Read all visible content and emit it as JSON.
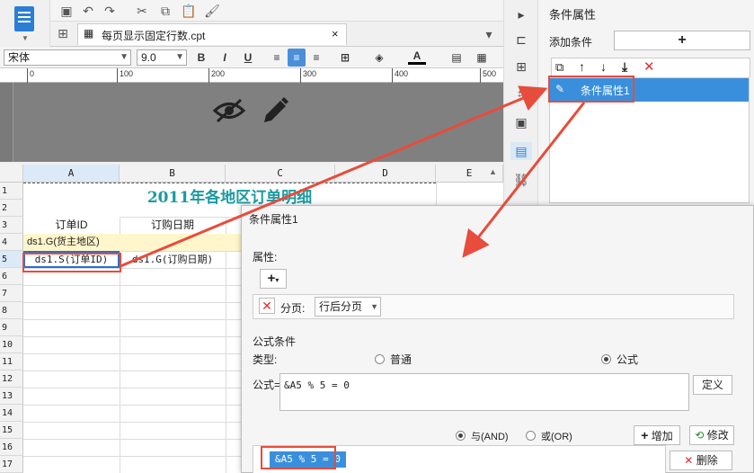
{
  "tab": {
    "filename": "每页显示固定行数.cpt"
  },
  "format": {
    "font": "宋体",
    "size": "9.0"
  },
  "ruler": {
    "marks": [
      "0",
      "100",
      "200",
      "300",
      "400",
      "500"
    ]
  },
  "sheet": {
    "columns": [
      "A",
      "B",
      "C",
      "D",
      "E"
    ],
    "rows": [
      "1 (H)",
      "2 (H)",
      "3 (H)",
      "4 (H)",
      "5",
      "6",
      "7",
      "8",
      "9",
      "10",
      "11",
      "12",
      "13",
      "14",
      "15",
      "16",
      "17"
    ],
    "title": "2011年各地区订单明细",
    "header_order_id": "订单ID",
    "header_order_date": "订购日期",
    "group_cell": "ds1.G(货主地区)",
    "cell_a5": "ds1.S(订单ID)",
    "cell_b5": "ds1.G(订购日期)"
  },
  "panel": {
    "title": "条件属性",
    "add_condition": "添加条件",
    "add_btn": "+",
    "item": "条件属性1"
  },
  "dialog": {
    "title": "条件属性1",
    "attr_label": "属性:",
    "pagebreak_label": "分页:",
    "pagebreak_value": "行后分页",
    "formula_section": "公式条件",
    "type_label": "类型:",
    "radio_normal": "普通",
    "radio_formula": "公式",
    "formula_label": "公式=",
    "formula_value": "&A5 % 5 = 0",
    "define_btn": "定义",
    "and_label": "与(AND)",
    "or_label": "或(OR)",
    "add_btn": "增加",
    "modify_btn": "修改",
    "delete_btn": "删除",
    "list_item": "&A5 % 5 = 0"
  },
  "colors": {
    "accent": "#3a8fdc",
    "highlight": "#e74c3c",
    "title_teal": "#1a9ba0"
  }
}
